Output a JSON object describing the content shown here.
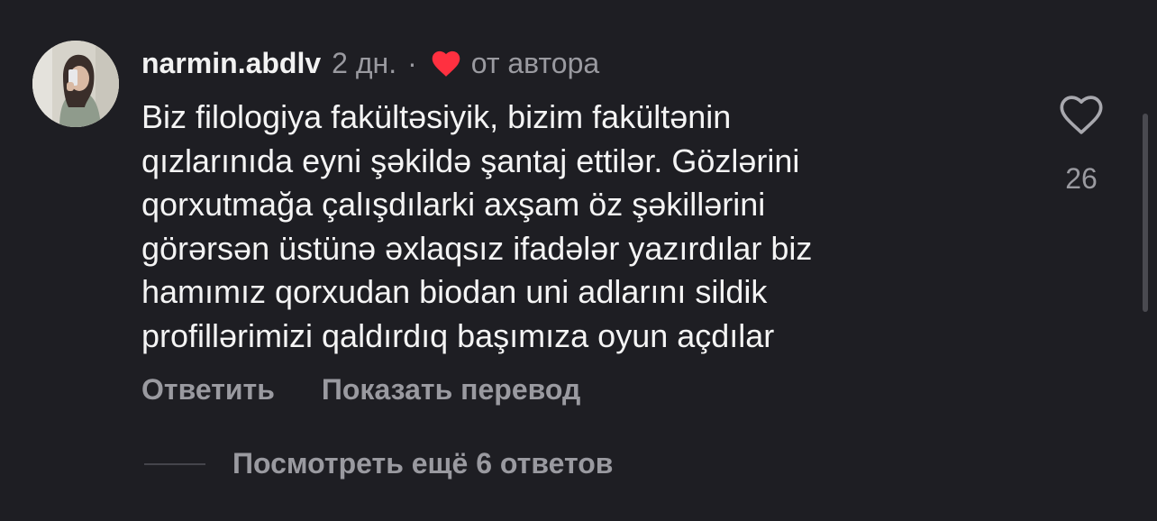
{
  "comment": {
    "username": "narmin.abdlv",
    "time": "2 дн.",
    "separator": "·",
    "author_heart_icon": "red-heart-icon",
    "author_label": "от автора",
    "text_lines": [
      "Biz filologiya fakültəsiyik, bizim fakültənin",
      "qızlarınıda eyni şəkildə şantaj ettilər. Gözlərini",
      "qorxutmağa çalışdılarki axşam öz şəkillərini",
      "görərsən üstünə əxlaqsız ifadələr yazırdılar biz",
      "hamımız qorxudan biodan uni adlarını sildik",
      "profillərimizi qaldırdıq başımıza oyun açdılar"
    ],
    "like_icon": "heart-outline-icon",
    "like_count": "26"
  },
  "actions": {
    "reply_label": "Ответить",
    "translate_label": "Показать перевод"
  },
  "replies": {
    "view_more_label": "Посмотреть ещё 6 ответов"
  },
  "colors": {
    "background": "#1e1e23",
    "primary_text": "#f4f4f4",
    "secondary_text": "#9a9aa0",
    "heart_red": "#ff3040"
  }
}
